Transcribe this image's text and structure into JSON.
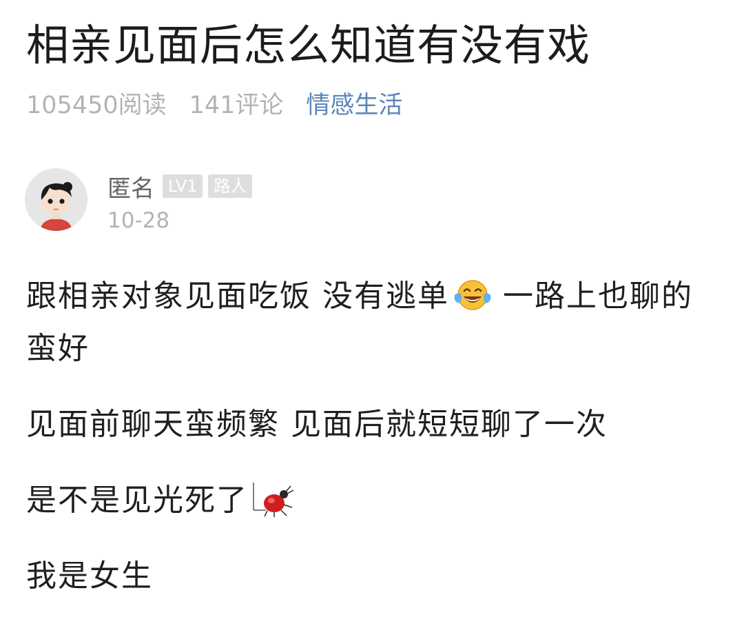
{
  "post": {
    "title": "相亲见面后怎么知道有没有戏",
    "reads": "105450阅读",
    "comments": "141评论",
    "category": "情感生活"
  },
  "author": {
    "name": "匿名",
    "level": "LV1",
    "rank": "路人",
    "date": "10-28"
  },
  "content": {
    "line1_a": "跟相亲对象见面吃饭 没有逃单",
    "line1_b": "一路上也聊的蛮好",
    "line2": "见面前聊天蛮频繁 见面后就短短聊了一次",
    "line3": "是不是见光死了",
    "line4": "我是女生"
  },
  "icons": {
    "avatar": "cartoon-avatar-icon",
    "laugh": "tears-of-joy-emoji-icon",
    "bug": "red-bug-emoji-icon"
  },
  "colors": {
    "category": "#5c85b8",
    "meta_gray": "#b3b3b3",
    "badge_bg": "#dedede"
  }
}
